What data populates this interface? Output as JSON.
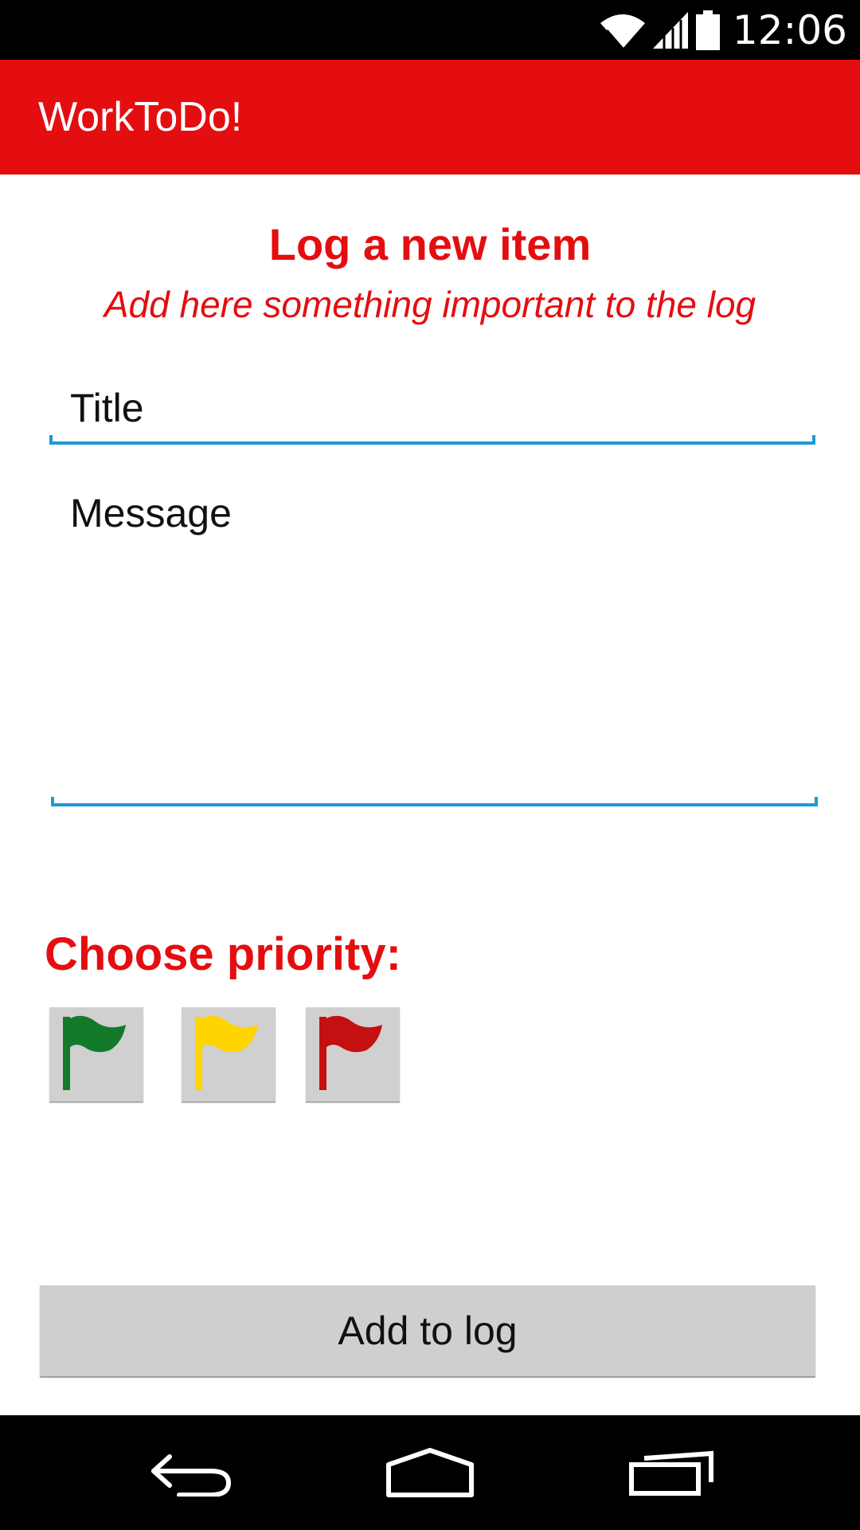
{
  "status_bar": {
    "time": "12:06"
  },
  "app_bar": {
    "title": "WorkToDo!"
  },
  "header": {
    "title": "Log a new item",
    "subtitle": "Add here something important to the log"
  },
  "form": {
    "title_placeholder": "Title",
    "message_placeholder": "Message"
  },
  "priority": {
    "label": "Choose priority:",
    "options": [
      {
        "icon": "green-flag-icon",
        "color": "#137a2c"
      },
      {
        "icon": "yellow-flag-icon",
        "color": "#ffd400"
      },
      {
        "icon": "red-flag-icon",
        "color": "#c41010"
      }
    ]
  },
  "actions": {
    "add_label": "Add to log"
  },
  "colors": {
    "accent": "#e40e10",
    "input_line": "#1e9ad6"
  }
}
